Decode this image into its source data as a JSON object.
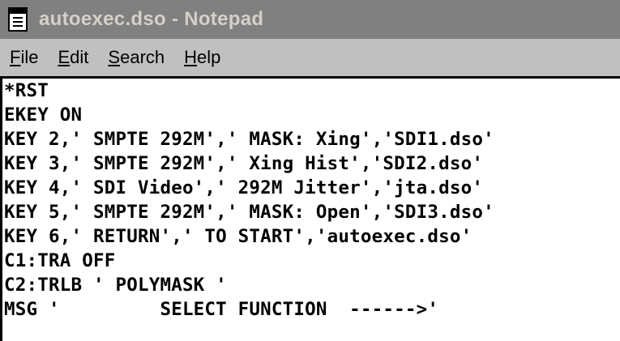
{
  "window": {
    "title": "autoexec.dso - Notepad",
    "icon": "notepad-icon"
  },
  "menu": {
    "file": {
      "mnemonic": "F",
      "rest": "ile"
    },
    "edit": {
      "mnemonic": "E",
      "rest": "dit"
    },
    "search": {
      "mnemonic": "S",
      "rest": "earch"
    },
    "help": {
      "mnemonic": "H",
      "rest": "elp"
    }
  },
  "editor": {
    "lines": [
      "*RST",
      "EKEY ON",
      "KEY 2,' SMPTE 292M',' MASK: Xing','SDI1.dso'",
      "KEY 3,' SMPTE 292M',' Xing Hist','SDI2.dso'",
      "KEY 4,' SDI Video',' 292M Jitter','jta.dso'",
      "KEY 5,' SMPTE 292M',' MASK: Open','SDI3.dso'",
      "KEY 6,' RETURN',' TO START','autoexec.dso'",
      "C1:TRA OFF",
      "C2:TRLB ' POLYMASK '",
      "MSG '         SELECT FUNCTION  ------>'"
    ]
  }
}
